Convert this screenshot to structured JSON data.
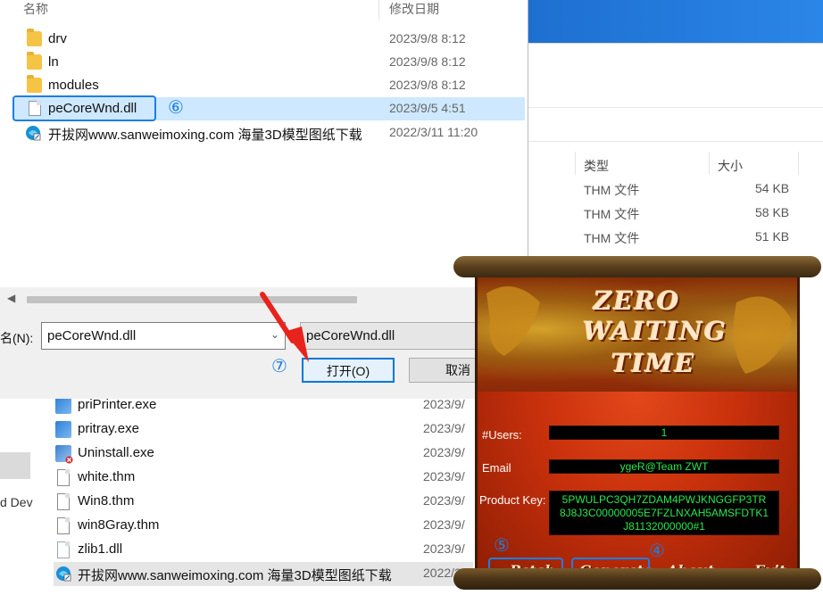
{
  "background_explorer": {
    "columns": {
      "type": "类型",
      "size": "大小"
    },
    "top_rows": [
      {
        "type": "THM 文件",
        "size": "54 KB"
      },
      {
        "type": "THM 文件",
        "size": "58 KB"
      },
      {
        "type": "THM 文件",
        "size": "51 KB"
      }
    ],
    "left_pane_text": "d Dev",
    "files": [
      {
        "name": "priPrinter.exe",
        "date": "2023/9/",
        "icon": "exe-icon"
      },
      {
        "name": "pritray.exe",
        "date": "2023/9/",
        "icon": "exe-icon"
      },
      {
        "name": "Uninstall.exe",
        "date": "2023/9/",
        "icon": "uninstall-icon"
      },
      {
        "name": "white.thm",
        "date": "2023/9/",
        "icon": "file-icon"
      },
      {
        "name": "Win8.thm",
        "date": "2023/9/",
        "icon": "file-icon"
      },
      {
        "name": "win8Gray.thm",
        "date": "2023/9/",
        "icon": "file-icon"
      },
      {
        "name": "zlib1.dll",
        "date": "2023/9/",
        "icon": "dll-icon"
      },
      {
        "name": "开拔网www.sanweimoxing.com 海量3D模型图纸下载",
        "date": "2022/3/",
        "icon": "link-icon"
      }
    ]
  },
  "file_dialog": {
    "columns": {
      "name": "名称",
      "modified": "修改日期"
    },
    "rows": [
      {
        "name": "drv",
        "date": "2023/9/8 8:12",
        "icon": "folder-icon"
      },
      {
        "name": "ln",
        "date": "2023/9/8 8:12",
        "icon": "folder-icon"
      },
      {
        "name": "modules",
        "date": "2023/9/8 8:12",
        "icon": "folder-icon"
      },
      {
        "name": "peCoreWnd.dll",
        "date": "2023/9/5 4:51",
        "icon": "dll-icon"
      },
      {
        "name": "开拔网www.sanweimoxing.com 海量3D模型图纸下载",
        "date": "2022/3/11 11:20",
        "icon": "link-icon"
      }
    ],
    "filename_label": "名(N):",
    "filename_value": "peCoreWnd.dll",
    "filetype_value": "peCoreWnd.dll",
    "open_label": "打开(O)",
    "cancel_label": "取消",
    "annotations": {
      "six": "⑥",
      "seven": "⑦"
    }
  },
  "keygen": {
    "title_lines": [
      "ZERO",
      "WAITING",
      "TIME"
    ],
    "users_label": "#Users:",
    "users_value": "1",
    "email_label": "Email",
    "email_value": "ygeR@Team ZWT",
    "key_label": "Product Key:",
    "key_lines": [
      "5PWULPC3QH7ZDAM4PWJKNGGFP3TR",
      "8J8J3C00000005E7FZLNXAH5AMSFDTK1",
      "J81132000000#1"
    ],
    "buttons": {
      "patch": "Patch",
      "generate": "Generate",
      "about": "About",
      "exit": "Exit"
    },
    "annotations": {
      "four": "④",
      "five": "⑤"
    }
  },
  "colors": {
    "accent": "#1e7ee0",
    "selection": "#cde8ff",
    "keygen_text": "#27e84a",
    "arrow": "#e8231c"
  }
}
